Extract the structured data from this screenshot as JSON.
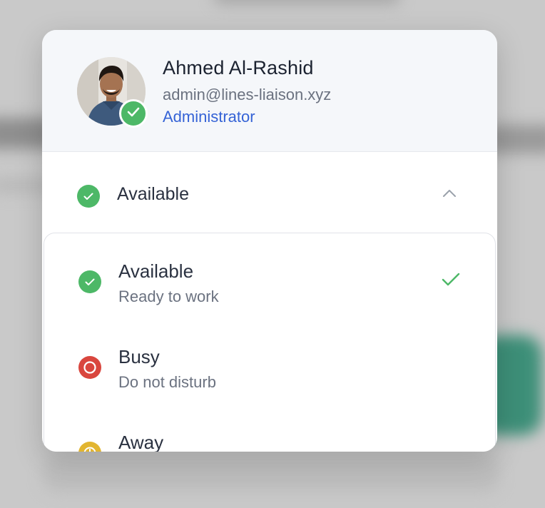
{
  "profile": {
    "name": "Ahmed Al-Rashid",
    "email": "admin@lines-liaison.xyz",
    "role": "Administrator",
    "avatar_icon": "user-avatar-photo",
    "badge_icon": "check-icon"
  },
  "current_status": {
    "label": "Available",
    "icon": "status-available-icon",
    "toggle_icon": "chevron-up-icon"
  },
  "status_options": [
    {
      "title": "Available",
      "description": "Ready to work",
      "icon": "check-circle-icon",
      "selected": true
    },
    {
      "title": "Busy",
      "description": "Do not disturb",
      "icon": "busy-circle-icon",
      "selected": false
    },
    {
      "title": "Away",
      "description": "",
      "icon": "away-clock-icon",
      "selected": false
    }
  ],
  "colors": {
    "available": "#4db867",
    "busy": "#d9463e",
    "away": "#e2b530",
    "accent": "#3563d6"
  }
}
